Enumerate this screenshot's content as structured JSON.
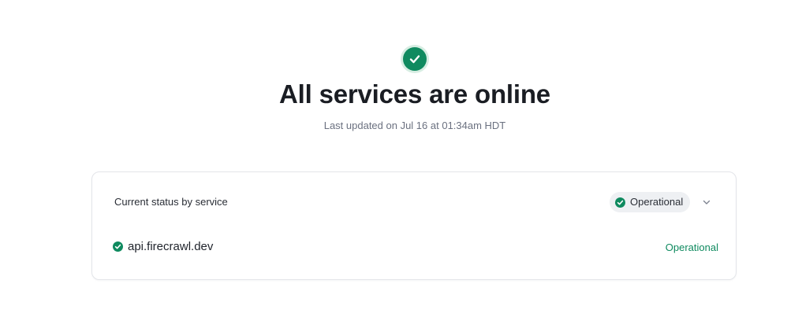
{
  "colors": {
    "operational_green": "#0f8a5f",
    "icon_ring": "#d6ede2",
    "pill_background": "#eef0f3"
  },
  "hero": {
    "icon": "check-circle-icon",
    "title": "All services are online",
    "subtitle": "Last updated on Jul 16 at 01:34am HDT"
  },
  "status_card": {
    "header_label": "Current status by service",
    "overall_status": {
      "icon": "check-circle-icon",
      "label": "Operational",
      "expand_icon": "chevron-down-icon"
    },
    "services": [
      {
        "icon": "check-circle-icon",
        "name": "api.firecrawl.dev",
        "status": "Operational"
      }
    ]
  }
}
